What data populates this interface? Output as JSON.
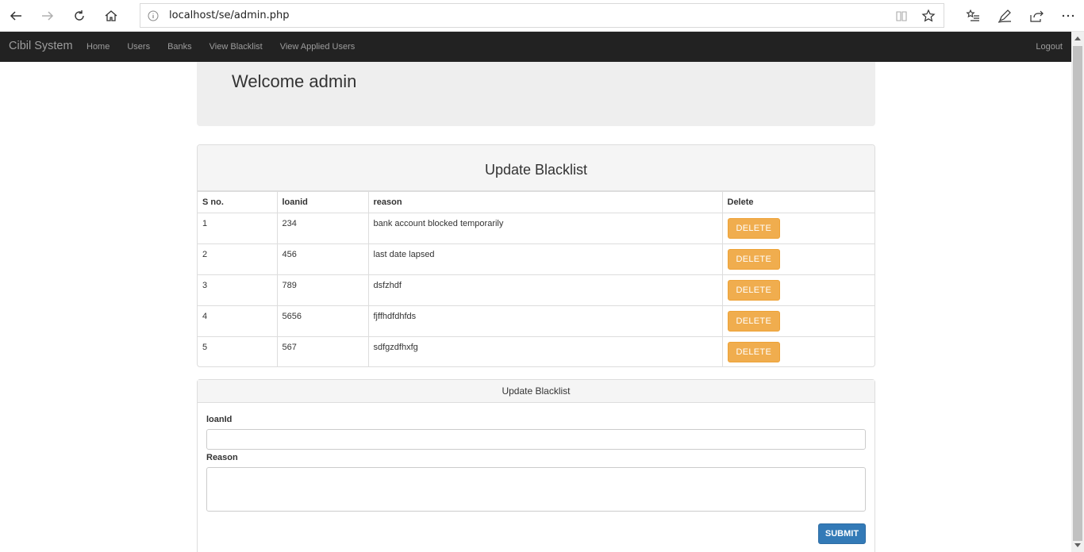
{
  "browser": {
    "url": "localhost/se/admin.php",
    "icons": [
      "back-icon",
      "forward-icon",
      "refresh-icon",
      "home-icon",
      "info-icon",
      "reading-view-icon",
      "favorite-star-icon",
      "favorites-list-icon",
      "pen-icon",
      "share-icon",
      "more-icon"
    ]
  },
  "navbar": {
    "brand": "Cibil System",
    "links": [
      "Home",
      "Users",
      "Banks",
      "View Blacklist",
      "View Applied Users"
    ],
    "logout": "Logout"
  },
  "jumbotron": {
    "title": "Welcome admin"
  },
  "blacklist": {
    "title": "Update Blacklist",
    "columns": [
      "S no.",
      "loanid",
      "reason",
      "Delete"
    ],
    "rows": [
      {
        "sno": "1",
        "loanid": "234",
        "reason": "bank account blocked temporarily",
        "action": "DELETE"
      },
      {
        "sno": "2",
        "loanid": "456",
        "reason": "last date lapsed",
        "action": "DELETE"
      },
      {
        "sno": "3",
        "loanid": "789",
        "reason": "dsfzhdf",
        "action": "DELETE"
      },
      {
        "sno": "4",
        "loanid": "5656",
        "reason": "fjffhdfdhfds",
        "action": "DELETE"
      },
      {
        "sno": "5",
        "loanid": "567",
        "reason": "sdfgzdfhxfg",
        "action": "DELETE"
      }
    ]
  },
  "form": {
    "title": "Update Blacklist",
    "loanid_label": "loanId",
    "loanid_value": "",
    "reason_label": "Reason",
    "reason_value": "",
    "submit_label": "SUBMIT"
  },
  "colors": {
    "navbar": "#222222",
    "delete": "#f0ad4e",
    "submit": "#337ab7"
  }
}
